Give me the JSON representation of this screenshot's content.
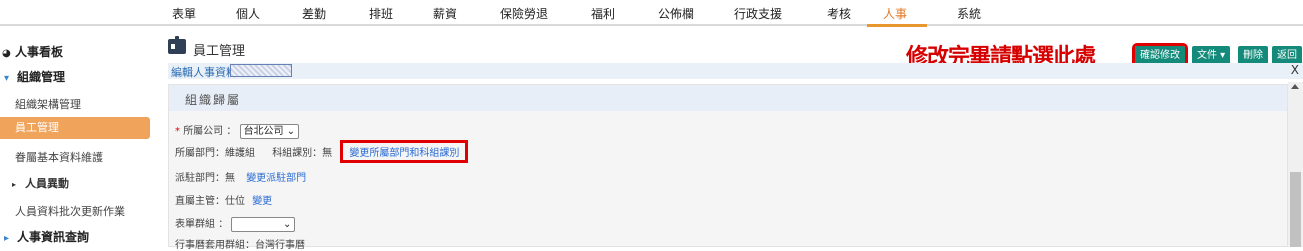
{
  "topnav": {
    "items": [
      "表單",
      "個人",
      "差勤",
      "排班",
      "薪資",
      "保險勞退",
      "福利",
      "公佈欄",
      "行政支援",
      "考核",
      "人事",
      "系統"
    ],
    "active": "人事"
  },
  "sidebar": {
    "items": [
      {
        "label": "人事看板",
        "icon": "pie-chart-icon"
      },
      {
        "label": "組織管理",
        "icon": "caret-down-icon"
      },
      {
        "label": "組織架構管理"
      },
      {
        "label": "員工管理"
      },
      {
        "label": "眷屬基本資料維護"
      },
      {
        "label": "人員異動",
        "icon": "caret-right-icon"
      },
      {
        "label": "人員資料批次更新作業"
      },
      {
        "label": "人事資訊查詢",
        "icon": "caret-right-icon"
      }
    ]
  },
  "header": {
    "title": "員工管理",
    "notice": "修改完畢請點選此處",
    "buttons": {
      "confirm": "確認修改",
      "file": "文件 ▾",
      "delete": "刪除",
      "back": "返回"
    }
  },
  "edit": {
    "label": "編輯人事資料:",
    "close": "X"
  },
  "panel": {
    "title": "組織歸屬",
    "company_label": "所屬公司",
    "company_value": "台北公司",
    "dept_label": "所屬部門：維護組",
    "section_label": "科組課別：無",
    "change_dept_link": "變更所屬部門和科組課別",
    "dispatch_label": "派駐部門：無",
    "dispatch_link": "變更派駐部門",
    "supervisor_label": "直屬主管：仕位",
    "supervisor_link": "變更",
    "form_group_label": "表單群組",
    "calendar_group_label": "行事曆套用群組：台灣行事曆"
  },
  "colors": {
    "accent": "#f0a35b",
    "button": "#138a7a",
    "notice": "#d60000",
    "link": "#2b6cd4"
  }
}
